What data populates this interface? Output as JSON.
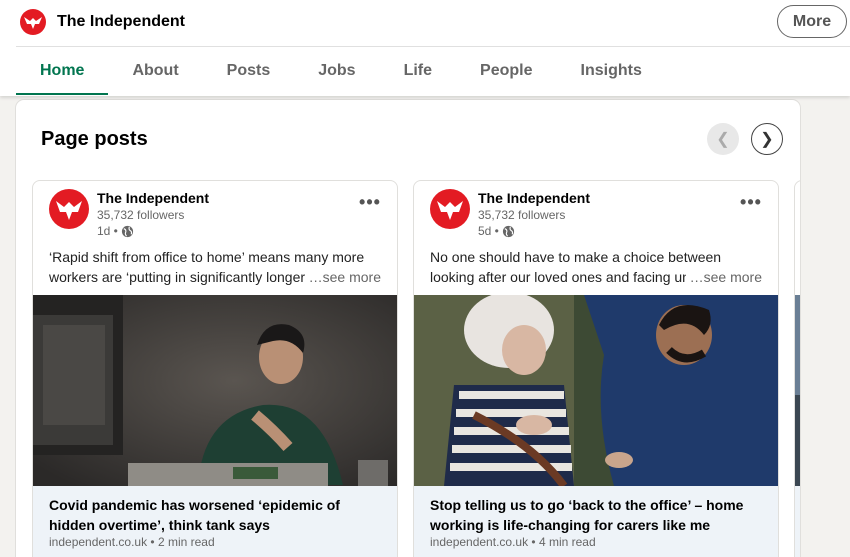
{
  "header": {
    "company_name": "The Independent",
    "more_label": "More",
    "logo_icon": "eagle-logo-icon",
    "brand_color": "#e31b23"
  },
  "tabs": [
    {
      "label": "Home",
      "active": true
    },
    {
      "label": "About"
    },
    {
      "label": "Posts"
    },
    {
      "label": "Jobs"
    },
    {
      "label": "Life"
    },
    {
      "label": "People"
    },
    {
      "label": "Insights"
    }
  ],
  "accent_color": "#01754f",
  "section": {
    "title": "Page posts",
    "prev_icon": "chevron-left-icon",
    "next_icon": "chevron-right-icon",
    "prev_glyph": "❮",
    "next_glyph": "❯"
  },
  "posts": [
    {
      "author": "The Independent",
      "followers": "35,732 followers",
      "time": "1d •",
      "text": "‘Rapid shift from office to home’ means many more workers are ‘putting in significantly longer",
      "see_more": "…see more",
      "menu_glyph": "•••",
      "image_desc_icon": "man-working-at-computer-photo",
      "link_title": "Covid pandemic has worsened ‘epidemic of hidden overtime’, think tank says",
      "link_meta": "independent.co.uk • 2 min read"
    },
    {
      "author": "The Independent",
      "followers": "35,732 followers",
      "time": "5d •",
      "text": "No one should have to make a choice between looking after our loved ones and facing unemployr",
      "see_more": "…see more",
      "menu_glyph": "•••",
      "image_desc_icon": "carer-with-elderly-woman-photo",
      "link_title": "Stop telling us to go ‘back to the office’ – home working is life-changing for carers like me",
      "link_meta": "independent.co.uk • 4 min read"
    }
  ]
}
